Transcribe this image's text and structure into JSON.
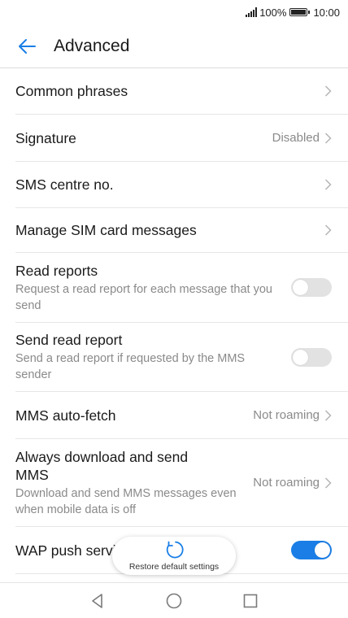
{
  "status_bar": {
    "battery": "100%",
    "time": "10:00"
  },
  "app_bar": {
    "title": "Advanced"
  },
  "items": [
    {
      "title": "Common phrases"
    },
    {
      "title": "Signature",
      "value": "Disabled"
    },
    {
      "title": "SMS centre no."
    },
    {
      "title": "Manage SIM card messages"
    },
    {
      "title": "Read reports",
      "description": "Request a read report for each message that you send",
      "toggle": "off"
    },
    {
      "title": "Send read report",
      "description": "Send a read report if requested by the MMS sender",
      "toggle": "off"
    },
    {
      "title": "MMS auto-fetch",
      "value": "Not roaming"
    },
    {
      "title": "Always download and send MMS",
      "description": "Download and send MMS messages even when mobile data is off",
      "value": "Not roaming"
    },
    {
      "title": "WAP push service",
      "toggle": "on"
    }
  ],
  "toast": {
    "label": "Restore default settings"
  },
  "colors": {
    "accent": "#1a7ee6",
    "toggle_off": "#e2e2e2",
    "secondary_text": "#8a8a8a"
  }
}
